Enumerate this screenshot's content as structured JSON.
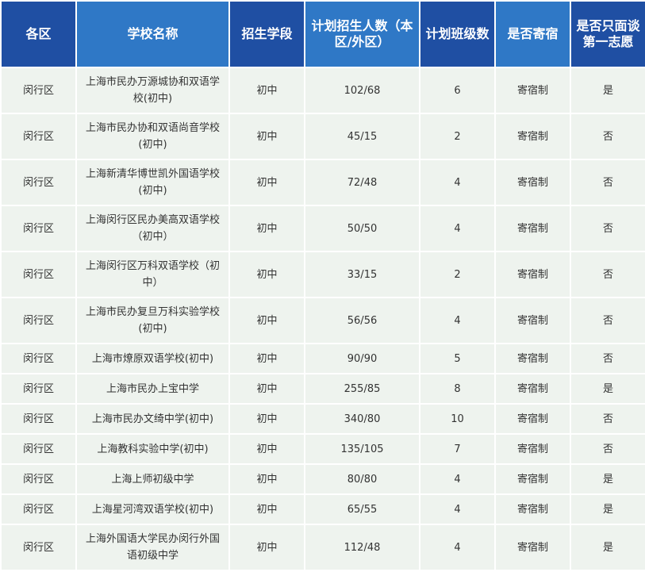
{
  "headers": [
    {
      "label": "各区",
      "style": "dark"
    },
    {
      "label": "学校名称",
      "style": "light"
    },
    {
      "label": "招生学段",
      "style": "dark"
    },
    {
      "label": "计划招生人数（本区/外区）",
      "style": "light"
    },
    {
      "label": "计划班级数",
      "style": "dark"
    },
    {
      "label": "是否寄宿",
      "style": "light"
    },
    {
      "label": "是否只面谈第一志愿",
      "style": "dark"
    }
  ],
  "rows": [
    {
      "district": "闵行区",
      "school": "上海市民办万源城协和双语学校(初中)",
      "stage": "初中",
      "plan": "102/68",
      "classes": "6",
      "boarding": "寄宿制",
      "first_choice": "是"
    },
    {
      "district": "闵行区",
      "school": "上海市民办协和双语尚音学校(初中)",
      "stage": "初中",
      "plan": "45/15",
      "classes": "2",
      "boarding": "寄宿制",
      "first_choice": "否"
    },
    {
      "district": "闵行区",
      "school": "上海新清华博世凯外国语学校(初中)",
      "stage": "初中",
      "plan": "72/48",
      "classes": "4",
      "boarding": "寄宿制",
      "first_choice": "否"
    },
    {
      "district": "闵行区",
      "school": "上海闵行区民办美高双语学校（初中）",
      "stage": "初中",
      "plan": "50/50",
      "classes": "4",
      "boarding": "寄宿制",
      "first_choice": "否"
    },
    {
      "district": "闵行区",
      "school": "上海闵行区万科双语学校（初中）",
      "stage": "初中",
      "plan": "33/15",
      "classes": "2",
      "boarding": "寄宿制",
      "first_choice": "否"
    },
    {
      "district": "闵行区",
      "school": "上海市民办复旦万科实验学校(初中)",
      "stage": "初中",
      "plan": "56/56",
      "classes": "4",
      "boarding": "寄宿制",
      "first_choice": "否"
    },
    {
      "district": "闵行区",
      "school": "上海市燎原双语学校(初中)",
      "stage": "初中",
      "plan": "90/90",
      "classes": "5",
      "boarding": "寄宿制",
      "first_choice": "否"
    },
    {
      "district": "闵行区",
      "school": "上海市民办上宝中学",
      "stage": "初中",
      "plan": "255/85",
      "classes": "8",
      "boarding": "寄宿制",
      "first_choice": "是"
    },
    {
      "district": "闵行区",
      "school": "上海市民办文绮中学(初中)",
      "stage": "初中",
      "plan": "340/80",
      "classes": "10",
      "boarding": "寄宿制",
      "first_choice": "否"
    },
    {
      "district": "闵行区",
      "school": "上海教科实验中学(初中)",
      "stage": "初中",
      "plan": "135/105",
      "classes": "7",
      "boarding": "寄宿制",
      "first_choice": "否"
    },
    {
      "district": "闵行区",
      "school": "上海上师初级中学",
      "stage": "初中",
      "plan": "80/80",
      "classes": "4",
      "boarding": "寄宿制",
      "first_choice": "是"
    },
    {
      "district": "闵行区",
      "school": "上海星河湾双语学校(初中)",
      "stage": "初中",
      "plan": "65/55",
      "classes": "4",
      "boarding": "寄宿制",
      "first_choice": "是"
    },
    {
      "district": "闵行区",
      "school": "上海外国语大学民办闵行外国语初级中学",
      "stage": "初中",
      "plan": "112/48",
      "classes": "4",
      "boarding": "寄宿制",
      "first_choice": "是"
    }
  ]
}
